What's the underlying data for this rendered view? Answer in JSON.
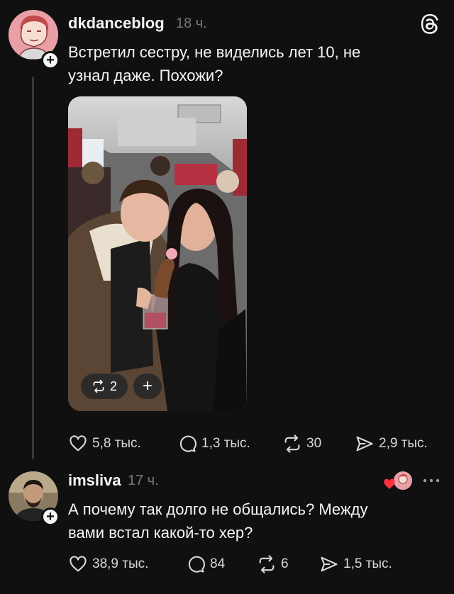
{
  "post": {
    "username": "dkdanceblog",
    "time": "18 ч.",
    "text_line1": "Встретил сестру, не виделись лет 10, не",
    "text_line2": "узнал даже. Похожи?",
    "photo_repost_count": "2",
    "likes": "5,8 тыс.",
    "comments": "1,3 тыс.",
    "reposts": "30",
    "shares": "2,9 тыс."
  },
  "reply": {
    "username": "imsliva",
    "time": "17 ч.",
    "text_line1": "А почему так долго не общались? Между",
    "text_line2": "вами встал какой-то хер?",
    "likes": "38,9 тыс.",
    "comments": "84",
    "reposts": "6",
    "shares": "1,5 тыс."
  },
  "icons": {
    "app_logo": "threads-icon",
    "more": "more-dots-icon"
  },
  "colors": {
    "background": "#101010",
    "text": "#f3f5f7",
    "muted": "#777777",
    "liked_heart": "#ff3040"
  }
}
